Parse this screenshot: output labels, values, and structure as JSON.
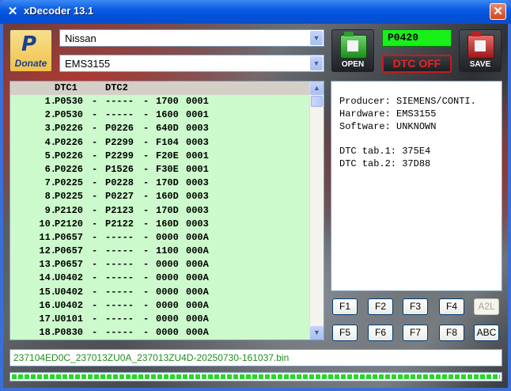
{
  "window": {
    "title": "xDecoder 13.1",
    "close_glyph": "✕",
    "app_glyph": "✕"
  },
  "donate": {
    "logo": "P",
    "label": "Donate"
  },
  "selectors": {
    "brand": "Nissan",
    "ecu": "EMS3155"
  },
  "buttons": {
    "open": "OPEN",
    "save": "SAVE",
    "dtc_off": "DTC OFF"
  },
  "dtc_display": "P0420",
  "list": {
    "headers": {
      "dtc1": "DTC1",
      "dtc2": "DTC2"
    },
    "rows": [
      {
        "num": "1.",
        "dtc1": "P0530",
        "dtc2": "-----",
        "addr": "1700",
        "code": "0001"
      },
      {
        "num": "2.",
        "dtc1": "P0530",
        "dtc2": "-----",
        "addr": "1600",
        "code": "0001"
      },
      {
        "num": "3.",
        "dtc1": "P0226",
        "dtc2": "P0226",
        "addr": "640D",
        "code": "0003"
      },
      {
        "num": "4.",
        "dtc1": "P0226",
        "dtc2": "P2299",
        "addr": "F104",
        "code": "0003"
      },
      {
        "num": "5.",
        "dtc1": "P0226",
        "dtc2": "P2299",
        "addr": "F20E",
        "code": "0001"
      },
      {
        "num": "6.",
        "dtc1": "P0226",
        "dtc2": "P1526",
        "addr": "F30E",
        "code": "0001"
      },
      {
        "num": "7.",
        "dtc1": "P0225",
        "dtc2": "P0228",
        "addr": "170D",
        "code": "0003"
      },
      {
        "num": "8.",
        "dtc1": "P0225",
        "dtc2": "P0227",
        "addr": "160D",
        "code": "0003"
      },
      {
        "num": "9.",
        "dtc1": "P2120",
        "dtc2": "P2123",
        "addr": "170D",
        "code": "0003"
      },
      {
        "num": "10.",
        "dtc1": "P2120",
        "dtc2": "P2122",
        "addr": "160D",
        "code": "0003"
      },
      {
        "num": "11.",
        "dtc1": "P0657",
        "dtc2": "-----",
        "addr": "0000",
        "code": "000A"
      },
      {
        "num": "12.",
        "dtc1": "P0657",
        "dtc2": "-----",
        "addr": "1100",
        "code": "000A"
      },
      {
        "num": "13.",
        "dtc1": "P0657",
        "dtc2": "-----",
        "addr": "0000",
        "code": "000A"
      },
      {
        "num": "14.",
        "dtc1": "U0402",
        "dtc2": "-----",
        "addr": "0000",
        "code": "000A"
      },
      {
        "num": "15.",
        "dtc1": "U0402",
        "dtc2": "-----",
        "addr": "0000",
        "code": "000A"
      },
      {
        "num": "16.",
        "dtc1": "U0402",
        "dtc2": "-----",
        "addr": "0000",
        "code": "000A"
      },
      {
        "num": "17.",
        "dtc1": "U0101",
        "dtc2": "-----",
        "addr": "0000",
        "code": "000A"
      },
      {
        "num": "18.",
        "dtc1": "P0830",
        "dtc2": "-----",
        "addr": "0000",
        "code": "000A"
      }
    ]
  },
  "info": {
    "producer": "Producer: SIEMENS/CONTI.",
    "hardware": "Hardware: EMS3155",
    "software": "Software: UNKNOWN",
    "tab1": "DTC tab.1: 375E4",
    "tab2": "DTC tab.2: 37D88"
  },
  "fkeys": {
    "f1": "F1",
    "f2": "F2",
    "f3": "F3",
    "f4": "F4",
    "a2l": "A2L",
    "f5": "F5",
    "f6": "F6",
    "f7": "F7",
    "f8": "F8",
    "abc": "ABC"
  },
  "status_file": "237104ED0C_237013ZU0A_237013ZU4D-20250730-161037.bin",
  "progress_fraction": 1.0,
  "colors": {
    "list_bg": "#ccfacc",
    "dtc_display_bg": "#18f018",
    "dtc_off_text": "#e52525",
    "status_text": "#1e8c1e"
  },
  "icons": {
    "open": "folder-open-icon",
    "save": "folder-save-icon",
    "donate": "paypal-icon",
    "dropdown": "chevron-down-icon"
  }
}
